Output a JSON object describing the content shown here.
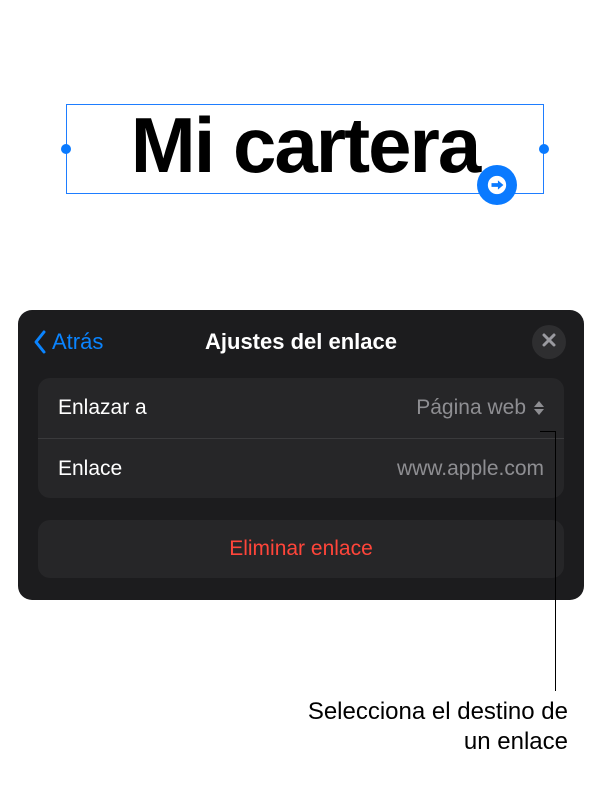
{
  "canvas": {
    "selected_text": "Mi cartera"
  },
  "panel": {
    "back_label": "Atrás",
    "title": "Ajustes del enlace",
    "rows": {
      "link_to": {
        "label": "Enlazar a",
        "value": "Página web"
      },
      "link": {
        "label": "Enlace",
        "value": "www.apple.com"
      }
    },
    "delete_label": "Eliminar enlace"
  },
  "callout": {
    "text": "Selecciona el destino de un enlace"
  },
  "colors": {
    "accent": "#0a84ff",
    "destructive": "#ff453a",
    "panel_bg": "#1c1c1e",
    "cell_bg": "#262628",
    "secondary_text": "#8e8e92"
  }
}
